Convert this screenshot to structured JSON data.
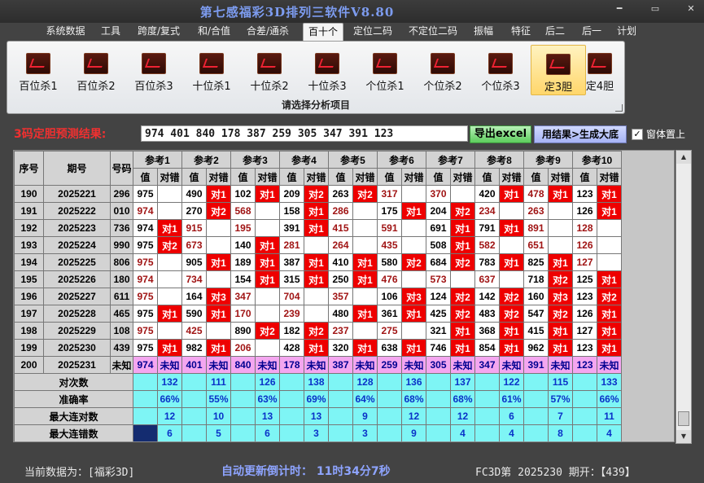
{
  "window": {
    "title": "第七感福彩3D排列三软件V8.80",
    "btn_min": "━",
    "btn_max": "▭",
    "btn_close": "✕"
  },
  "menu": [
    "系统数据",
    "工具",
    "跨度/复式",
    "和/合值",
    "合差/通杀",
    "百十个",
    "定位二码",
    "不定位二码",
    "振幅",
    "特征",
    "后二",
    "后一",
    "计划"
  ],
  "menu_active": 5,
  "ribbon": {
    "buttons": [
      "百位杀1",
      "百位杀2",
      "百位杀3",
      "十位杀1",
      "十位杀2",
      "十位杀3",
      "个位杀1",
      "个位杀2",
      "个位杀3",
      "定3胆",
      "定4胆"
    ],
    "selected": 9,
    "group_label": "请选择分析项目"
  },
  "prediction": {
    "label": "3码定胆预测结果:",
    "value": "974 401 840 178 387 259 305 347 391 123",
    "export_btn": "导出excel",
    "gen_btn": "用结果>生成大底",
    "pin_label": "窗体置上",
    "pin_checked": "✓"
  },
  "table": {
    "headers": {
      "seq": "序号",
      "period": "期号",
      "code": "号码",
      "val": "值",
      "mark": "对错"
    },
    "refs": [
      "参考1",
      "参考2",
      "参考3",
      "参考4",
      "参考5",
      "参考6",
      "参考7",
      "参考8",
      "参考9",
      "参考10"
    ],
    "rows": [
      {
        "seq": "190",
        "period": "2025221",
        "code": "296",
        "cells": [
          [
            "975",
            "w",
            ""
          ],
          [
            "490",
            "w",
            "对1"
          ],
          [
            "102",
            "w",
            "对1"
          ],
          [
            "209",
            "w",
            "对2"
          ],
          [
            "263",
            "w",
            "对2"
          ],
          [
            "317",
            "r",
            ""
          ],
          [
            "370",
            "r",
            ""
          ],
          [
            "420",
            "w",
            "对1"
          ],
          [
            "478",
            "r",
            "对1"
          ],
          [
            "123",
            "w",
            "对1"
          ]
        ]
      },
      {
        "seq": "191",
        "period": "2025222",
        "code": "010",
        "cells": [
          [
            "974",
            "r",
            ""
          ],
          [
            "270",
            "w",
            "对2"
          ],
          [
            "568",
            "r",
            ""
          ],
          [
            "158",
            "w",
            "对1"
          ],
          [
            "286",
            "r",
            ""
          ],
          [
            "175",
            "w",
            "对1"
          ],
          [
            "204",
            "w",
            "对2"
          ],
          [
            "234",
            "r",
            ""
          ],
          [
            "263",
            "r",
            ""
          ],
          [
            "126",
            "w",
            "对1"
          ]
        ]
      },
      {
        "seq": "192",
        "period": "2025223",
        "code": "736",
        "cells": [
          [
            "974",
            "w",
            "对1"
          ],
          [
            "915",
            "r",
            ""
          ],
          [
            "195",
            "r",
            ""
          ],
          [
            "391",
            "w",
            "对1"
          ],
          [
            "415",
            "r",
            ""
          ],
          [
            "591",
            "r",
            ""
          ],
          [
            "691",
            "w",
            "对1"
          ],
          [
            "791",
            "w",
            "对1"
          ],
          [
            "891",
            "r",
            ""
          ],
          [
            "128",
            "r",
            ""
          ]
        ]
      },
      {
        "seq": "193",
        "period": "2025224",
        "code": "990",
        "cells": [
          [
            "975",
            "w",
            "对2"
          ],
          [
            "673",
            "r",
            ""
          ],
          [
            "140",
            "w",
            "对1"
          ],
          [
            "281",
            "r",
            ""
          ],
          [
            "264",
            "r",
            ""
          ],
          [
            "435",
            "r",
            ""
          ],
          [
            "508",
            "w",
            "对1"
          ],
          [
            "582",
            "r",
            ""
          ],
          [
            "651",
            "r",
            ""
          ],
          [
            "126",
            "r",
            ""
          ]
        ]
      },
      {
        "seq": "194",
        "period": "2025225",
        "code": "806",
        "cells": [
          [
            "975",
            "r",
            ""
          ],
          [
            "905",
            "w",
            "对1"
          ],
          [
            "189",
            "w",
            "对1"
          ],
          [
            "387",
            "w",
            "对1"
          ],
          [
            "410",
            "w",
            "对1"
          ],
          [
            "580",
            "w",
            "对2"
          ],
          [
            "684",
            "w",
            "对2"
          ],
          [
            "783",
            "w",
            "对1"
          ],
          [
            "825",
            "w",
            "对1"
          ],
          [
            "127",
            "r",
            ""
          ]
        ]
      },
      {
        "seq": "195",
        "period": "2025226",
        "code": "180",
        "cells": [
          [
            "974",
            "r",
            ""
          ],
          [
            "734",
            "r",
            ""
          ],
          [
            "154",
            "w",
            "对1"
          ],
          [
            "315",
            "w",
            "对1"
          ],
          [
            "250",
            "w",
            "对1"
          ],
          [
            "476",
            "r",
            ""
          ],
          [
            "573",
            "r",
            ""
          ],
          [
            "637",
            "r",
            ""
          ],
          [
            "718",
            "w",
            "对2"
          ],
          [
            "125",
            "w",
            "对1"
          ]
        ]
      },
      {
        "seq": "196",
        "period": "2025227",
        "code": "611",
        "cells": [
          [
            "975",
            "r",
            ""
          ],
          [
            "164",
            "w",
            "对3"
          ],
          [
            "347",
            "r",
            ""
          ],
          [
            "704",
            "r",
            ""
          ],
          [
            "357",
            "r",
            ""
          ],
          [
            "106",
            "w",
            "对3"
          ],
          [
            "124",
            "w",
            "对2"
          ],
          [
            "142",
            "w",
            "对2"
          ],
          [
            "160",
            "w",
            "对3"
          ],
          [
            "123",
            "w",
            "对2"
          ]
        ]
      },
      {
        "seq": "197",
        "period": "2025228",
        "code": "465",
        "cells": [
          [
            "975",
            "w",
            "对1"
          ],
          [
            "590",
            "w",
            "对1"
          ],
          [
            "170",
            "r",
            ""
          ],
          [
            "239",
            "r",
            ""
          ],
          [
            "480",
            "w",
            "对1"
          ],
          [
            "361",
            "w",
            "对1"
          ],
          [
            "425",
            "w",
            "对2"
          ],
          [
            "483",
            "w",
            "对2"
          ],
          [
            "547",
            "w",
            "对2"
          ],
          [
            "126",
            "w",
            "对1"
          ]
        ]
      },
      {
        "seq": "198",
        "period": "2025229",
        "code": "108",
        "cells": [
          [
            "975",
            "r",
            ""
          ],
          [
            "425",
            "r",
            ""
          ],
          [
            "890",
            "w",
            "对2"
          ],
          [
            "182",
            "w",
            "对2"
          ],
          [
            "237",
            "r",
            ""
          ],
          [
            "275",
            "r",
            ""
          ],
          [
            "321",
            "w",
            "对1"
          ],
          [
            "368",
            "w",
            "对1"
          ],
          [
            "415",
            "w",
            "对1"
          ],
          [
            "127",
            "w",
            "对1"
          ]
        ]
      },
      {
        "seq": "199",
        "period": "2025230",
        "code": "439",
        "cells": [
          [
            "975",
            "w",
            "对1"
          ],
          [
            "982",
            "w",
            "对1"
          ],
          [
            "206",
            "r",
            ""
          ],
          [
            "428",
            "w",
            "对1"
          ],
          [
            "320",
            "w",
            "对1"
          ],
          [
            "638",
            "w",
            "对1"
          ],
          [
            "746",
            "w",
            "对1"
          ],
          [
            "854",
            "w",
            "对1"
          ],
          [
            "962",
            "w",
            "对1"
          ],
          [
            "123",
            "w",
            "对1"
          ]
        ]
      }
    ],
    "unknown_row": {
      "seq": "200",
      "period": "2025231",
      "code": "未知",
      "vals": [
        "974",
        "401",
        "840",
        "178",
        "387",
        "259",
        "305",
        "347",
        "391",
        "123"
      ],
      "mark": "未知"
    },
    "stats": [
      {
        "label": "对次数",
        "vals": [
          "132",
          "111",
          "126",
          "138",
          "128",
          "136",
          "137",
          "122",
          "115",
          "133"
        ]
      },
      {
        "label": "准确率",
        "vals": [
          "66%",
          "55%",
          "63%",
          "69%",
          "64%",
          "68%",
          "68%",
          "61%",
          "57%",
          "66%"
        ]
      },
      {
        "label": "最大连对数",
        "vals": [
          "12",
          "10",
          "13",
          "13",
          "9",
          "12",
          "12",
          "6",
          "7",
          "11"
        ]
      },
      {
        "label": "最大连错数",
        "vals": [
          "6",
          "5",
          "6",
          "3",
          "3",
          "9",
          "4",
          "4",
          "8",
          "4"
        ]
      }
    ]
  },
  "scroll": {
    "up": "▲",
    "down": "▼"
  },
  "status": {
    "current": "当前数据为：[福彩3D]",
    "countdown": "自动更新倒计时： 11时34分7秒",
    "issue": "FC3D第 2025230 期开：【439】"
  }
}
